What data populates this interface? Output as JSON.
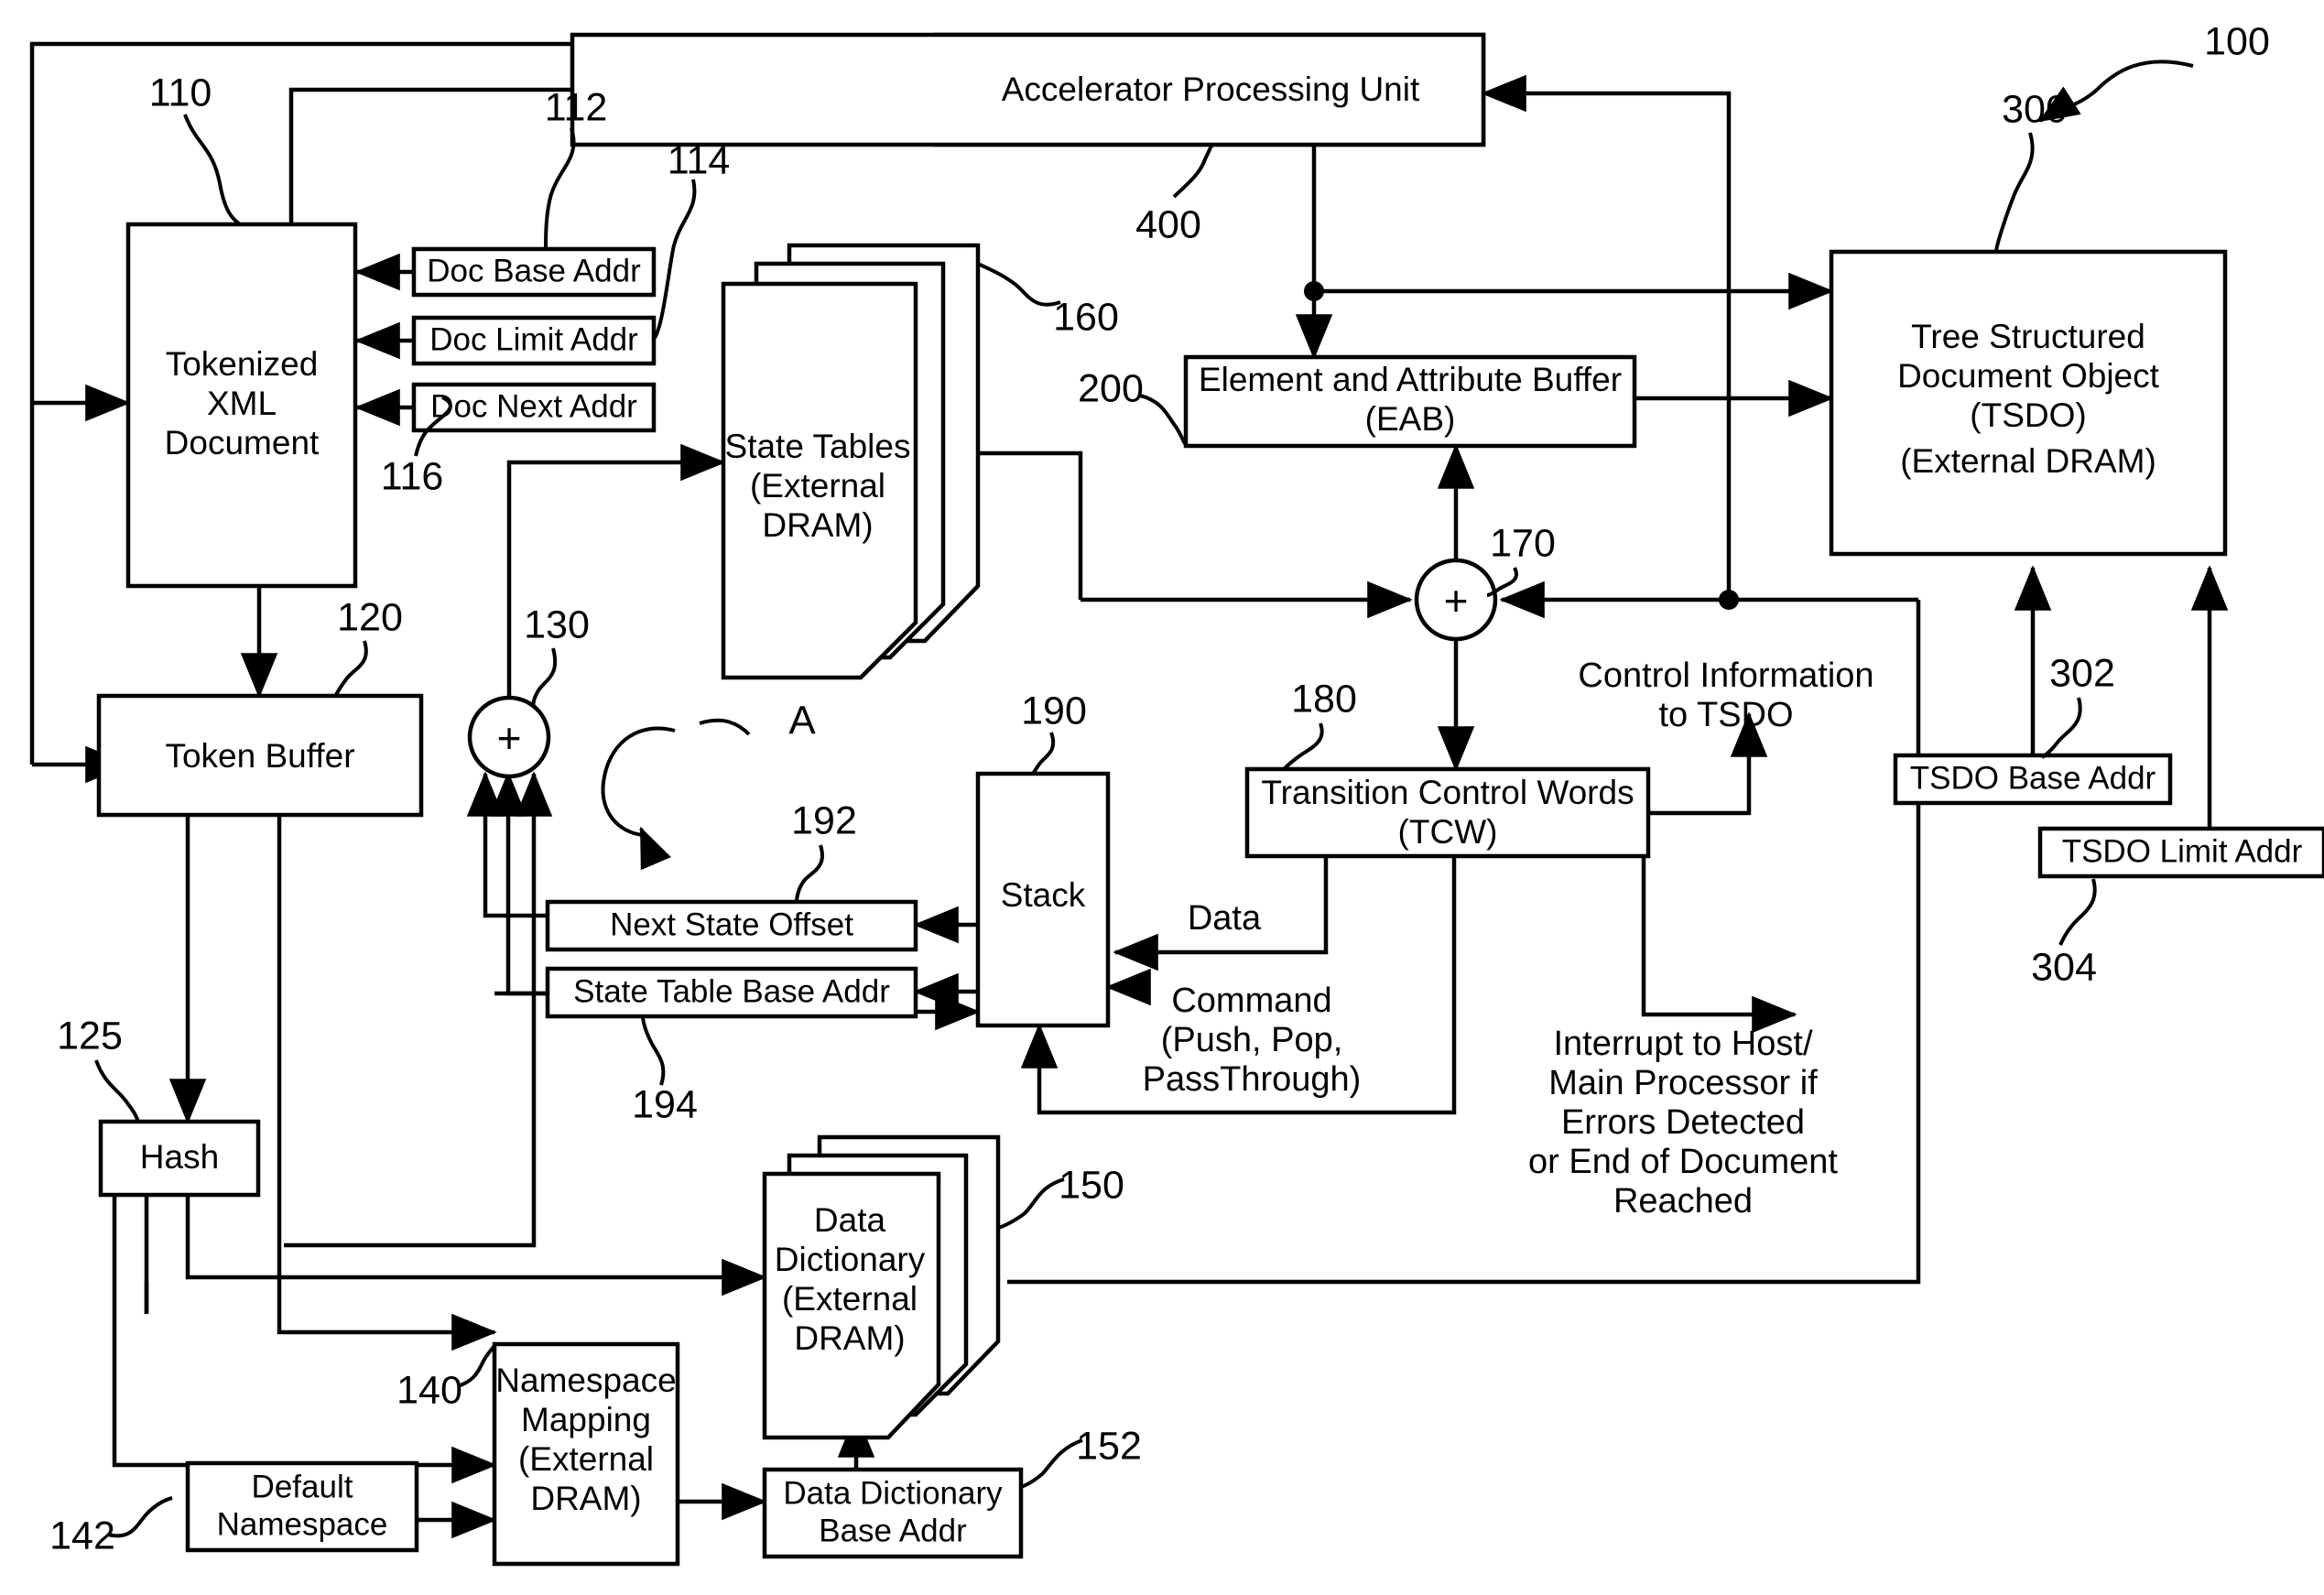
{
  "figure": {
    "ref_main": "100",
    "callout_A": "A"
  },
  "blocks": {
    "apu": {
      "label": "Accelerator Processing Unit",
      "ref": "400"
    },
    "tokenized_xml": {
      "lines": [
        "Tokenized",
        "XML",
        "Document"
      ],
      "ref": "110"
    },
    "doc_base_addr": {
      "label": "Doc Base Addr",
      "ref": "112"
    },
    "doc_limit_addr": {
      "label": "Doc Limit Addr",
      "ref": "114"
    },
    "doc_next_addr": {
      "label": "Doc Next Addr",
      "ref": "116"
    },
    "state_tables": {
      "lines": [
        "State Tables",
        "(External",
        "DRAM)"
      ],
      "ref": "160"
    },
    "eab": {
      "lines": [
        "Element and Attribute Buffer",
        "(EAB)"
      ],
      "ref": "200"
    },
    "tsdo": {
      "lines": [
        "Tree Structured",
        "Document Object",
        "(TSDO)",
        "(External DRAM)"
      ],
      "ref": "300"
    },
    "tsdo_base_addr": {
      "label": "TSDO Base Addr",
      "ref": "302"
    },
    "tsdo_limit_addr": {
      "label": "TSDO Limit Addr",
      "ref": "304"
    },
    "token_buffer": {
      "label": "Token Buffer",
      "ref": "120"
    },
    "adder_130": {
      "symbol": "+",
      "ref": "130"
    },
    "adder_170": {
      "symbol": "+",
      "ref": "170"
    },
    "hash": {
      "label": "Hash",
      "ref": "125"
    },
    "stack": {
      "label": "Stack",
      "ref": "190"
    },
    "next_state_offset": {
      "label": "Next State Offset",
      "ref": "192"
    },
    "state_table_base_addr": {
      "label": "State Table Base Addr",
      "ref": "194"
    },
    "tcw": {
      "lines": [
        "Transition Control Words",
        "(TCW)"
      ],
      "ref": "180"
    },
    "data_dictionary": {
      "lines": [
        "Data",
        "Dictionary",
        "(External",
        "DRAM)"
      ],
      "ref": "150"
    },
    "data_dictionary_base_addr": {
      "lines": [
        "Data Dictionary",
        "Base Addr"
      ],
      "ref": "152"
    },
    "namespace_mapping": {
      "lines": [
        "Namespace",
        "Mapping",
        "(External",
        "DRAM)"
      ],
      "ref": "140"
    },
    "default_namespace": {
      "lines": [
        "Default",
        "Namespace"
      ],
      "ref": "142"
    }
  },
  "annotations": {
    "control_info": {
      "lines": [
        "Control Information",
        "to TSDO"
      ]
    },
    "interrupt": {
      "lines": [
        "Interrupt to Host/",
        "Main Processor if",
        "Errors Detected",
        "or End of Document",
        "Reached"
      ]
    },
    "data_label": {
      "label": "Data"
    },
    "command_label": {
      "lines": [
        "Command",
        "(Push, Pop,",
        "PassThrough)"
      ]
    }
  },
  "colors": {
    "ink": "#000000",
    "paper": "#ffffff"
  }
}
